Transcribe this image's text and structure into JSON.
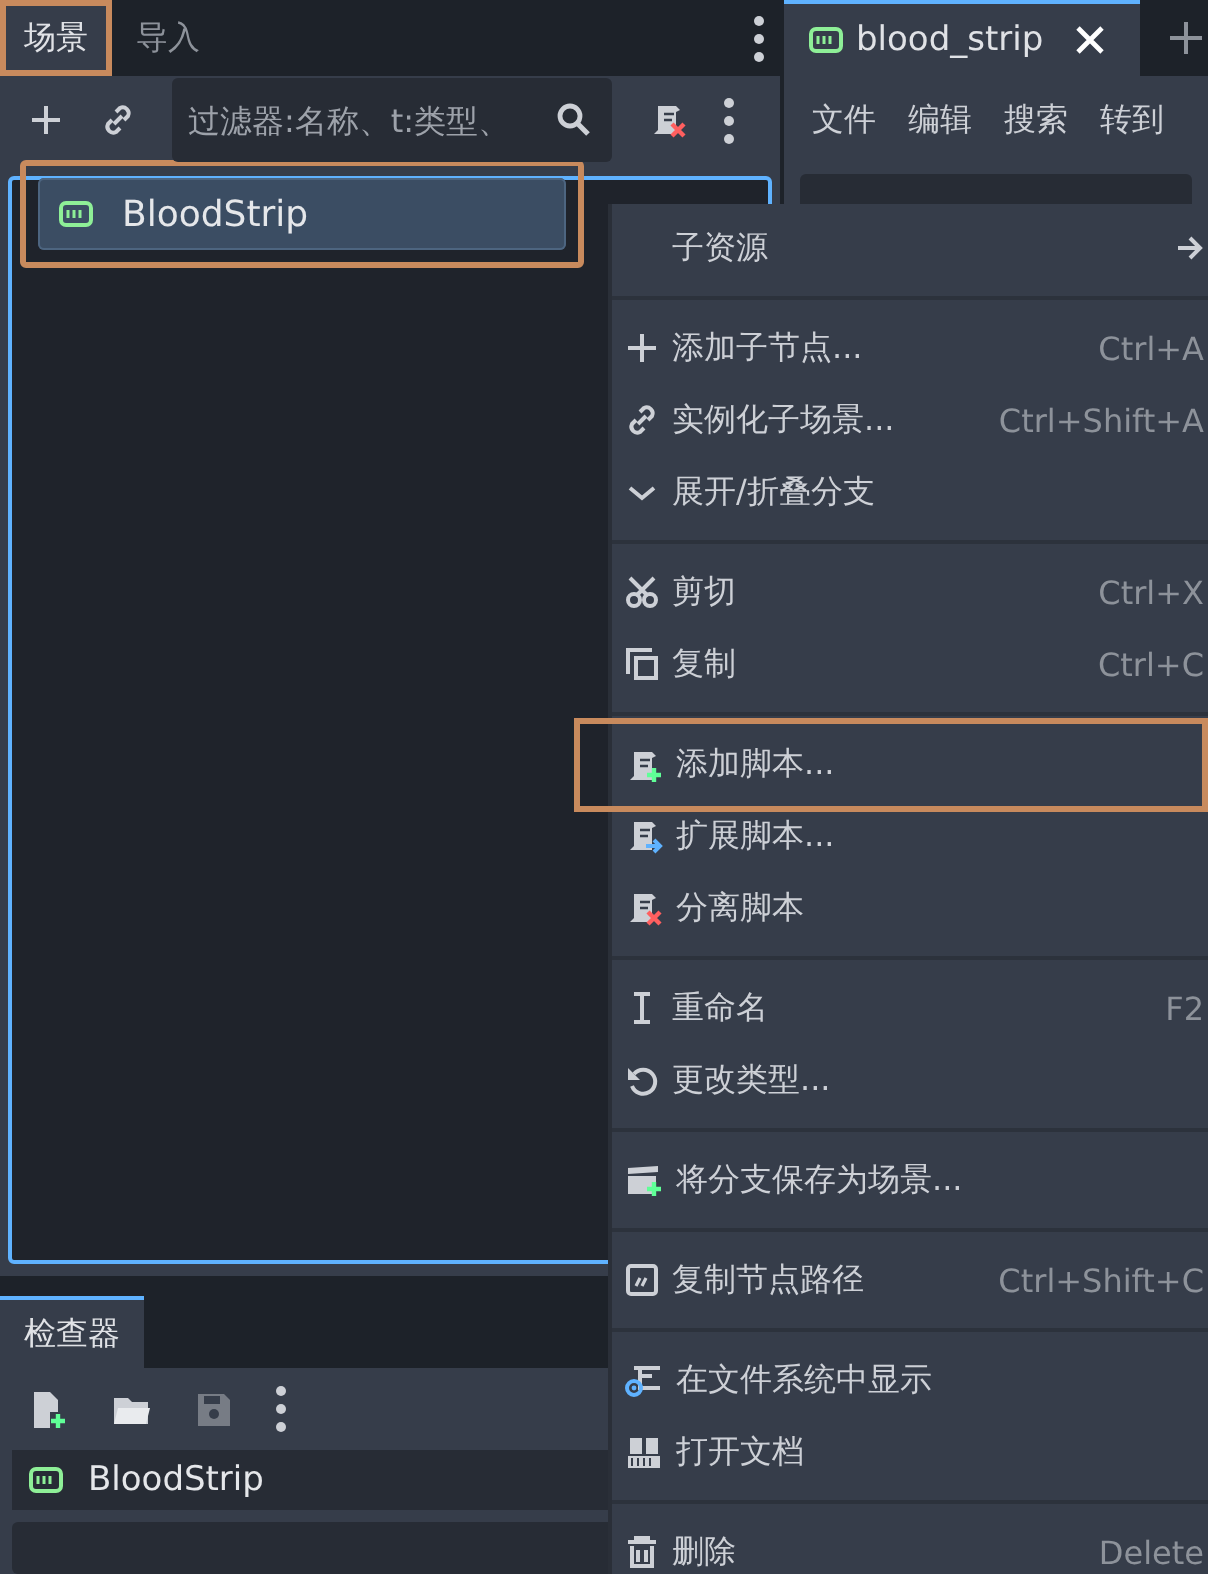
{
  "scene_dock": {
    "tabs": [
      {
        "label": "场景",
        "selected": true,
        "highlighted": true
      },
      {
        "label": "导入",
        "selected": false,
        "highlighted": false
      }
    ],
    "filter": {
      "placeholder": "过滤器:名称、t:类型、"
    },
    "tree": [
      {
        "label": "BloodStrip",
        "selected": true,
        "highlighted": true
      }
    ]
  },
  "script_editor": {
    "tabs": [
      {
        "label": "blood_strip",
        "selected": true
      }
    ],
    "menus": [
      "文件",
      "编辑",
      "搜索",
      "转到"
    ]
  },
  "inspector": {
    "tabs": [
      {
        "label": "检查器",
        "selected": true
      }
    ],
    "node": "BloodStrip"
  },
  "context_menu": {
    "groups": [
      [
        {
          "label": "子资源",
          "submenu": true,
          "highlighted": false
        }
      ],
      [
        {
          "label": "添加子节点...",
          "shortcut": "Ctrl+A",
          "submenu": false,
          "highlighted": false
        },
        {
          "label": "实例化子场景...",
          "shortcut": "Ctrl+Shift+A",
          "submenu": false,
          "highlighted": false
        },
        {
          "label": "展开/折叠分支",
          "submenu": false,
          "highlighted": false
        }
      ],
      [
        {
          "label": "剪切",
          "shortcut": "Ctrl+X",
          "submenu": false,
          "highlighted": false
        },
        {
          "label": "复制",
          "shortcut": "Ctrl+C",
          "submenu": false,
          "highlighted": false
        }
      ],
      [
        {
          "label": "添加脚本...",
          "submenu": false,
          "highlighted": true
        },
        {
          "label": "扩展脚本...",
          "submenu": false,
          "highlighted": false
        },
        {
          "label": "分离脚本",
          "submenu": false,
          "highlighted": false
        }
      ],
      [
        {
          "label": "重命名",
          "shortcut": "F2",
          "submenu": false,
          "highlighted": false
        },
        {
          "label": "更改类型...",
          "submenu": false,
          "highlighted": false
        }
      ],
      [
        {
          "label": "将分支保存为场景...",
          "submenu": false,
          "highlighted": false
        }
      ],
      [
        {
          "label": "复制节点路径",
          "shortcut": "Ctrl+Shift+C",
          "submenu": false,
          "highlighted": false
        }
      ],
      [
        {
          "label": "在文件系统中显示",
          "submenu": false,
          "highlighted": false
        },
        {
          "label": "打开文档",
          "submenu": false,
          "highlighted": false
        }
      ],
      [
        {
          "label": "删除",
          "shortcut": "Delete",
          "submenu": false,
          "highlighted": false
        }
      ]
    ]
  }
}
